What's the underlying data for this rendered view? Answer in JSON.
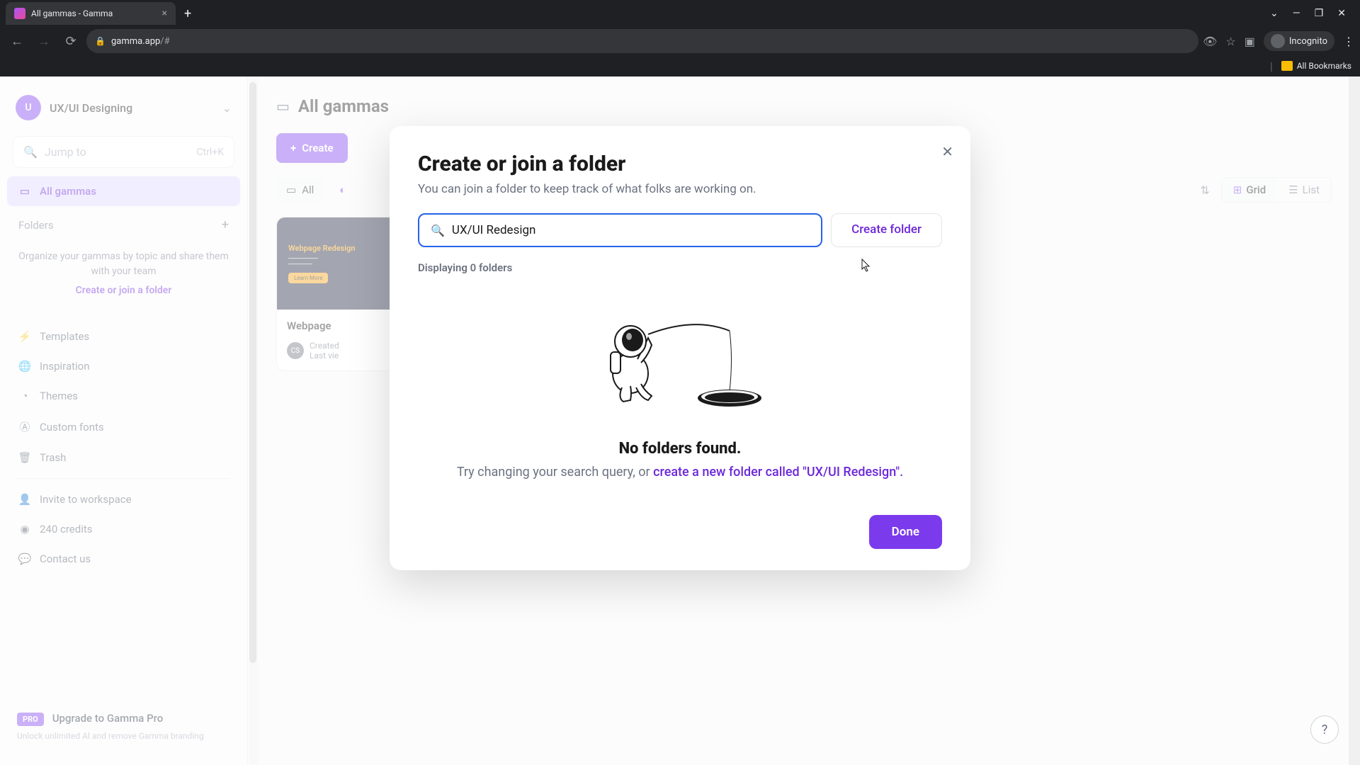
{
  "browser": {
    "tab_title": "All gammas - Gamma",
    "url_domain": "gamma.app",
    "url_path": "/#",
    "incognito_label": "Incognito",
    "bookmarks_label": "All Bookmarks"
  },
  "sidebar": {
    "workspace_initial": "U",
    "workspace_name": "UX/UI Designing",
    "jump_to_placeholder": "Jump to",
    "jump_to_shortcut": "Ctrl+K",
    "all_gammas": "All gammas",
    "folders_header": "Folders",
    "folder_empty_text": "Organize your gammas by topic and share them with your team",
    "folder_empty_link": "Create or join a folder",
    "templates": "Templates",
    "inspiration": "Inspiration",
    "themes": "Themes",
    "custom_fonts": "Custom fonts",
    "trash": "Trash",
    "invite": "Invite to workspace",
    "credits": "240 credits",
    "contact": "Contact us",
    "pro_badge": "PRO",
    "upgrade_title": "Upgrade to Gamma Pro",
    "upgrade_desc": "Unlock unlimited AI and remove Gamma branding"
  },
  "main": {
    "page_title": "All gammas",
    "create_btn": "Create",
    "filter_all": "All",
    "sort_label": "Sort",
    "view_grid": "Grid",
    "view_list": "List",
    "card": {
      "thumb_title": "Webpage Redesign",
      "thumb_btn": "Learn More",
      "title": "Webpage",
      "avatar": "CS",
      "created": "Created",
      "last_view": "Last vie"
    }
  },
  "modal": {
    "title": "Create or join a folder",
    "subtitle": "You can join a folder to keep track of what folks are working on.",
    "search_value": "UX/UI Redesign",
    "create_folder_btn": "Create folder",
    "result_count": "Displaying 0 folders",
    "empty_title": "No folders found.",
    "empty_desc_prefix": "Try changing your search query, or ",
    "empty_link": "create a new folder called \"UX/UI Redesign\".",
    "done_btn": "Done"
  }
}
